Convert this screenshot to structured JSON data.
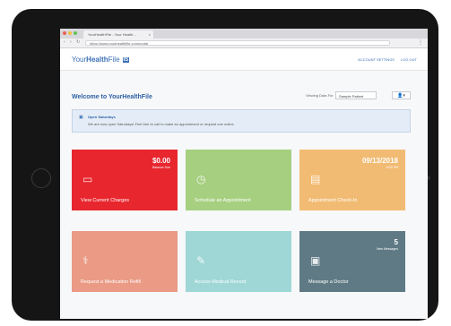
{
  "browser": {
    "tab_title": "YourHealthFile - Your Health...",
    "tab_close": "×",
    "url": "https://www.yourhealthfile.com/portal",
    "back_icon": "‹",
    "forward_icon": "›",
    "reload_icon": "↻",
    "menu_icon": "⋮"
  },
  "app": {
    "logo_prefix": "Your",
    "logo_bold": "Health",
    "logo_suffix": "File",
    "logo_badge": "IS",
    "account_settings": "ACCOUNT SETTINGS",
    "logout": "LOG OUT"
  },
  "welcome": {
    "title": "Welcome to YourHealthFile",
    "view_data_for": "Viewing Data For",
    "selected_patient": "Sample Patient",
    "user_icon": "👤▾"
  },
  "alert": {
    "title": "Open Saturdays",
    "body": "We are now open Saturdays! Feel free to call to make an appointment or request one online."
  },
  "tiles": [
    {
      "label": "View Current Charges",
      "stat": "$0.00",
      "sub": "Balance Due",
      "color": "#e8262e",
      "icon": "card-icon",
      "glyph": "▭"
    },
    {
      "label": "Schedule an Appointment",
      "stat": "",
      "sub": "",
      "color": "#a6cf80",
      "icon": "clock-icon",
      "glyph": "◷"
    },
    {
      "label": "Appointment Check-In",
      "stat": "09/13/2018",
      "sub": "6:00 PM",
      "color": "#f2bb73",
      "icon": "clipboard-icon",
      "glyph": "▤"
    },
    {
      "label": "Request a Medication Refill",
      "stat": "",
      "sub": "",
      "color": "#ea9a85",
      "icon": "pills-icon",
      "glyph": "⚕"
    },
    {
      "label": "Access Medical Record",
      "stat": "",
      "sub": "",
      "color": "#9ed7d6",
      "icon": "pen-icon",
      "glyph": "✎"
    },
    {
      "label": "Message a Doctor",
      "stat": "5",
      "sub": "New Messages",
      "color": "#5f7a84",
      "icon": "monitor-icon",
      "glyph": "▣"
    }
  ]
}
